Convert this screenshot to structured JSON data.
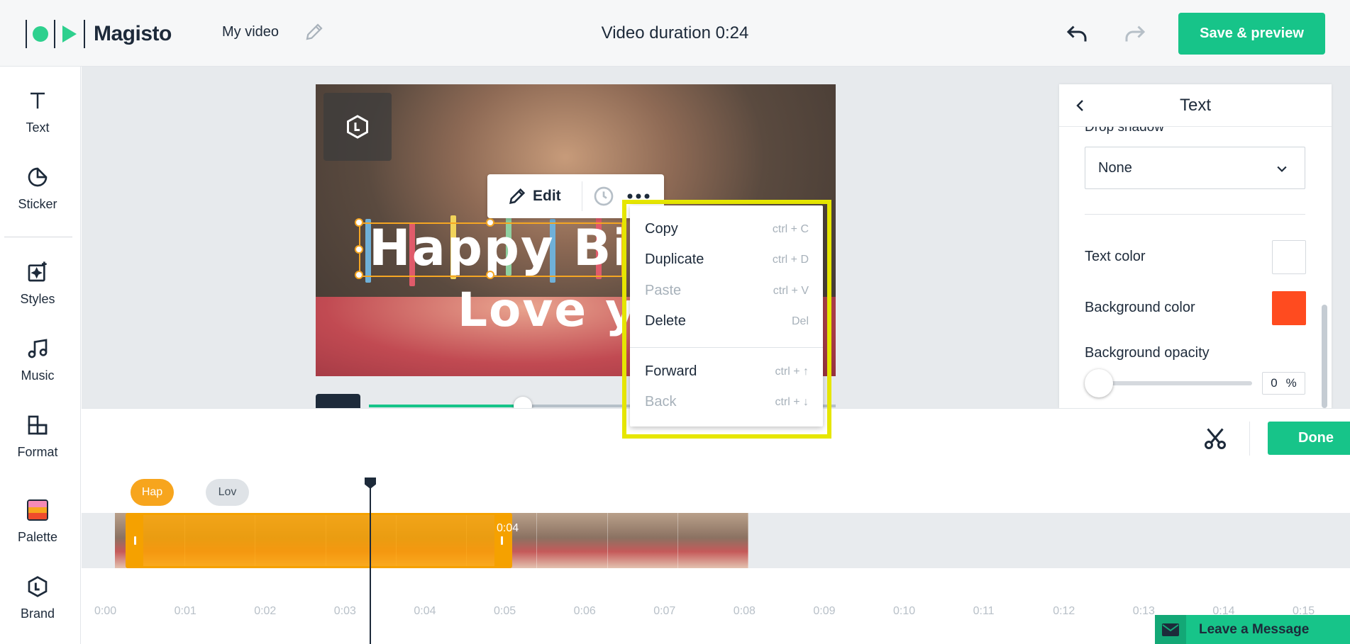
{
  "header": {
    "brand": "Magisto",
    "video_title": "My video",
    "duration": "Video duration 0:24",
    "save_label": "Save & preview"
  },
  "sidebar": {
    "items": [
      {
        "label": "Text",
        "icon": "text-icon"
      },
      {
        "label": "Sticker",
        "icon": "sticker-icon"
      },
      {
        "label": "Styles",
        "icon": "styles-icon"
      },
      {
        "label": "Music",
        "icon": "music-icon"
      },
      {
        "label": "Format",
        "icon": "format-icon"
      },
      {
        "label": "Palette",
        "icon": "palette-icon"
      },
      {
        "label": "Brand",
        "icon": "brand-icon"
      }
    ]
  },
  "canvas": {
    "line1": "Happy Bir",
    "line2": "Love y",
    "edit_label": "Edit",
    "progress": 0.33
  },
  "context_menu": {
    "items": [
      {
        "label": "Copy",
        "shortcut": "ctrl + C",
        "disabled": false
      },
      {
        "label": "Duplicate",
        "shortcut": "ctrl + D",
        "disabled": false
      },
      {
        "label": "Paste",
        "shortcut": "ctrl + V",
        "disabled": true
      },
      {
        "label": "Delete",
        "shortcut": "Del",
        "disabled": false
      },
      {
        "label": "Forward",
        "shortcut": "ctrl + ↑",
        "disabled": false
      },
      {
        "label": "Back",
        "shortcut": "ctrl + ↓",
        "disabled": true
      }
    ]
  },
  "right_panel": {
    "title": "Text",
    "drop_shadow_label": "Drop shadow",
    "drop_shadow_value": "None",
    "text_color_label": "Text color",
    "text_color": "#ffffff",
    "background_color_label": "Background color",
    "background_color": "#ff4b1f",
    "background_opacity_label": "Background opacity",
    "background_opacity_value": "0",
    "percent_sign": "%"
  },
  "bottom_bar": {
    "done_label": "Done"
  },
  "timeline": {
    "bubble_hap": "Hap",
    "bubble_lov": "Lov",
    "clip_time": "0:04",
    "ruler": [
      "0:00",
      "0:01",
      "0:02",
      "0:03",
      "0:04",
      "0:05",
      "0:06",
      "0:07",
      "0:08",
      "0:09",
      "0:10",
      "0:11",
      "0:12",
      "0:13",
      "0:14",
      "0:15"
    ]
  },
  "chat": {
    "label": "Leave a Message"
  },
  "colors": {
    "accent": "#17c489",
    "highlight": "#e6e600",
    "selection": "#f5a623"
  }
}
